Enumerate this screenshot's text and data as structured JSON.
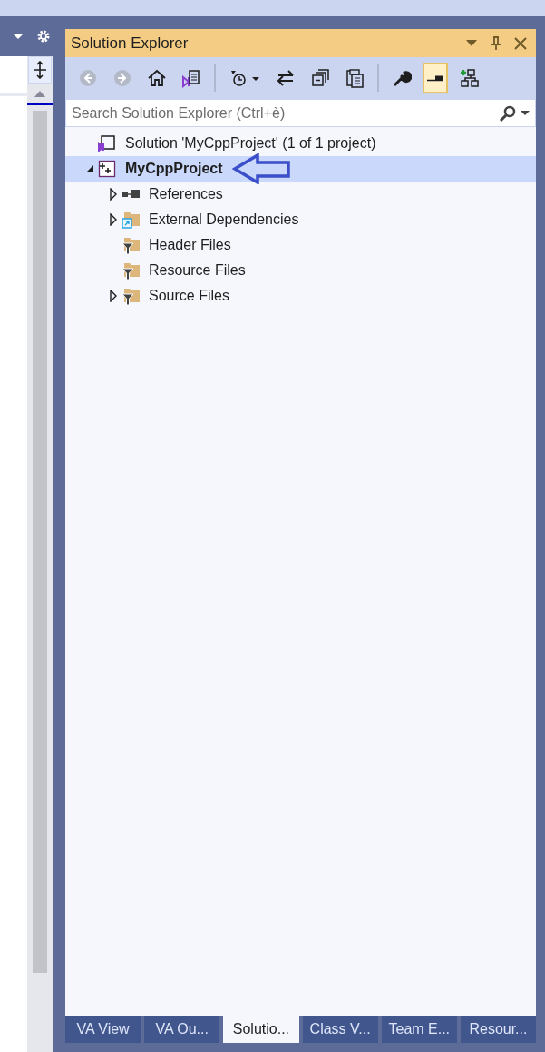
{
  "panel": {
    "title": "Solution Explorer"
  },
  "toolbar": [
    {
      "kind": "back",
      "disabled": true
    },
    {
      "kind": "forward",
      "disabled": true
    },
    {
      "kind": "home",
      "disabled": false
    },
    {
      "kind": "switch-views",
      "disabled": false
    },
    {
      "kind": "separator"
    },
    {
      "kind": "pending-changes",
      "disabled": false
    },
    {
      "kind": "sync",
      "disabled": false
    },
    {
      "kind": "collapse",
      "disabled": false
    },
    {
      "kind": "show-all",
      "disabled": false
    },
    {
      "kind": "separator"
    },
    {
      "kind": "properties",
      "disabled": false
    },
    {
      "kind": "preview",
      "disabled": false,
      "selected": true
    },
    {
      "kind": "diagram",
      "disabled": false
    }
  ],
  "search": {
    "placeholder": "Search Solution Explorer (Ctrl+è)"
  },
  "tree": [
    {
      "label": "Solution 'MyCppProject' (1 of 1 project)",
      "kind": "solution",
      "selected": false,
      "children": [
        {
          "label": "MyCppProject",
          "kind": "project",
          "selected": true,
          "expanded": true,
          "children": [
            {
              "label": "References",
              "kind": "references",
              "selected": false,
              "expanded": false
            },
            {
              "label": "External Dependencies",
              "kind": "external",
              "selected": false,
              "expanded": false
            },
            {
              "label": "Header Files",
              "kind": "filter",
              "selected": false
            },
            {
              "label": "Resource Files",
              "kind": "filter",
              "selected": false
            },
            {
              "label": "Source Files",
              "kind": "filter",
              "selected": false,
              "expanded": false
            }
          ]
        }
      ]
    }
  ],
  "tabs": [
    {
      "label": "VA View",
      "selected": false
    },
    {
      "label": "VA Ou...",
      "selected": false
    },
    {
      "label": "Solutio...",
      "selected": true
    },
    {
      "label": "Class V...",
      "selected": false
    },
    {
      "label": "Team E...",
      "selected": false
    },
    {
      "label": "Resour...",
      "selected": false
    }
  ]
}
